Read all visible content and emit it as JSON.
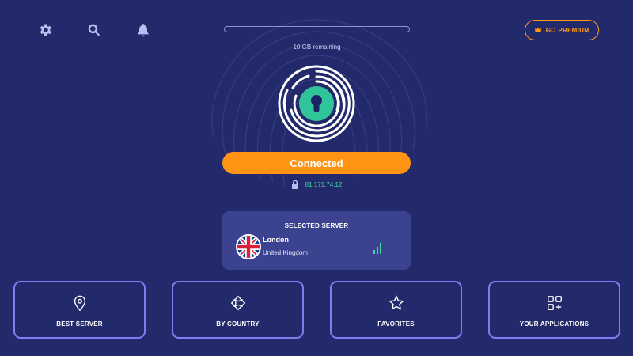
{
  "toolbar": {
    "icons": [
      "gear-icon",
      "search-icon",
      "bell-icon"
    ]
  },
  "data_usage": {
    "label": "10 GB remaining",
    "used_fraction": 0
  },
  "premium": {
    "label": "GO PREMIUM",
    "icon": "crown-icon"
  },
  "connection": {
    "status": "Connected",
    "ip": "81.171.74.12"
  },
  "selected_server": {
    "heading": "SELECTED SERVER",
    "city": "London",
    "country": "United Kingdom",
    "flag": "uk-flag-icon",
    "signal_icon": "signal-bars-icon"
  },
  "tiles": [
    {
      "label": "BEST SERVER",
      "icon": "location-pin-icon"
    },
    {
      "label": "BY COUNTRY",
      "icon": "globe-icon"
    },
    {
      "label": "FAVORITES",
      "icon": "star-icon"
    },
    {
      "label": "YOUR APPLICATIONS",
      "icon": "apps-grid-icon"
    }
  ],
  "colors": {
    "background": "#232a6b",
    "accent_orange": "#ff9414",
    "connected_green": "#3ed6a2",
    "card_bg": "#3b4390",
    "tile_border": "#7b7ff0"
  }
}
